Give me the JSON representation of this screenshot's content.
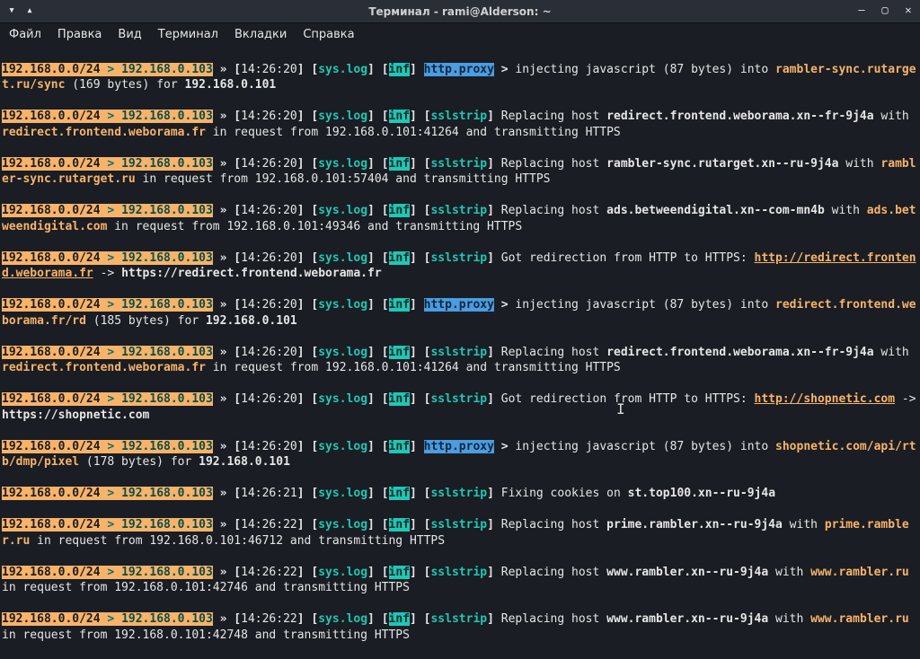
{
  "window": {
    "title": "Терминал - rami@Alderson: ~",
    "controls": {
      "menu": "▾",
      "fullscreen": "▴",
      "min": "–",
      "max": "▢",
      "close": "✕"
    }
  },
  "menu": {
    "file": "Файл",
    "edit": "Правка",
    "view": "Вид",
    "terminal": "Терминал",
    "tabs": "Вкладки",
    "help": "Справка"
  },
  "common": {
    "net1": "192.168.0.0/24",
    "net2": "192.168.0.103",
    "arrow": " > ",
    "raquo": " » ",
    "lbr": "[",
    "rbr": "]",
    "syslog": "sys.log",
    "inf": "inf",
    "proxy": "http.proxy",
    "sslstrip": "sslstrip",
    "gt": " > "
  },
  "log": {
    "t0": "14:26:20",
    "t1": "14:26:21",
    "t2": "14:26:22",
    "l1a": "injecting javascript (87 bytes) into ",
    "l1host": "rambler-sync.rutarget.ru/sync",
    "l1b": " (169 bytes) for ",
    "l1ip": "192.168.0.101",
    "l2a": "Replacing host ",
    "l2h1": "redirect.frontend.weborama.xn--fr-9j4a",
    "l2b": " with ",
    "l2h2": "redirect.frontend.weborama.fr",
    "l2c": " in request from 192.168.0.101:41264 and transmitting HTTPS",
    "l3a": "Replacing host ",
    "l3h1": "rambler-sync.rutarget.xn--ru-9j4a",
    "l3b": " with ",
    "l3h2": "rambler-sync.rutarget.ru",
    "l3c": " in request from 192.168.0.101:57404 and transmitting HTTPS",
    "l4a": "Replacing host ",
    "l4h1": "ads.betweendigital.xn--com-mn4b",
    "l4b": " with ",
    "l4h2": "ads.betweendigital.com",
    "l4c": " in request from 192.168.0.101:49346 and transmitting HTTPS",
    "l5a": "Got redirection from HTTP to HTTPS: ",
    "l5url": "http://redirect.frontend.weborama.fr",
    "l5arrow": " -> ",
    "l5tgt": "https://redirect.frontend.weborama.fr",
    "l6a": "injecting javascript (87 bytes) into ",
    "l6host": "redirect.frontend.weborama.fr/rd",
    "l6b": " (185 bytes) for ",
    "l6ip": "192.168.0.101",
    "l7a": "Replacing host ",
    "l7h1": "redirect.frontend.weborama.xn--fr-9j4a",
    "l7b": " with ",
    "l7h2": "redirect.frontend.weborama.fr",
    "l7c": " in request from 192.168.0.101:41264 and transmitting HTTPS",
    "l8a": "Got redirection from HTTP to HTTPS: ",
    "l8url": "http://shopnetic.com",
    "l8arrow": " -> ",
    "l8tgt": "https://shopnetic.com",
    "l9a": "injecting javascript (87 bytes) into ",
    "l9host": "shopnetic.com/api/rtb/dmp/pixel",
    "l9b": " (178 bytes) for ",
    "l9ip": "192.168.0.101",
    "l10a": "Fixing cookies on ",
    "l10h": "st.top100.xn--ru-9j4a",
    "l11a": "Replacing host ",
    "l11h1": "prime.rambler.xn--ru-9j4a",
    "l11b": " with ",
    "l11h2": "prime.rambler.ru",
    "l11c": " in request from 192.168.0.101:46712 and transmitting HTTPS",
    "l12a": "Replacing host ",
    "l12h1": "www.rambler.xn--ru-9j4a",
    "l12b": " with ",
    "l12h2": "www.rambler.ru",
    "l12c": " in request from 192.168.0.101:42746 and transmitting HTTPS",
    "l13a": "Replacing host ",
    "l13h1": "www.rambler.xn--ru-9j4a",
    "l13b": " with ",
    "l13h2": "www.rambler.ru",
    "l13c": " in request from 192.168.0.101:42748 and transmitting HTTPS"
  }
}
